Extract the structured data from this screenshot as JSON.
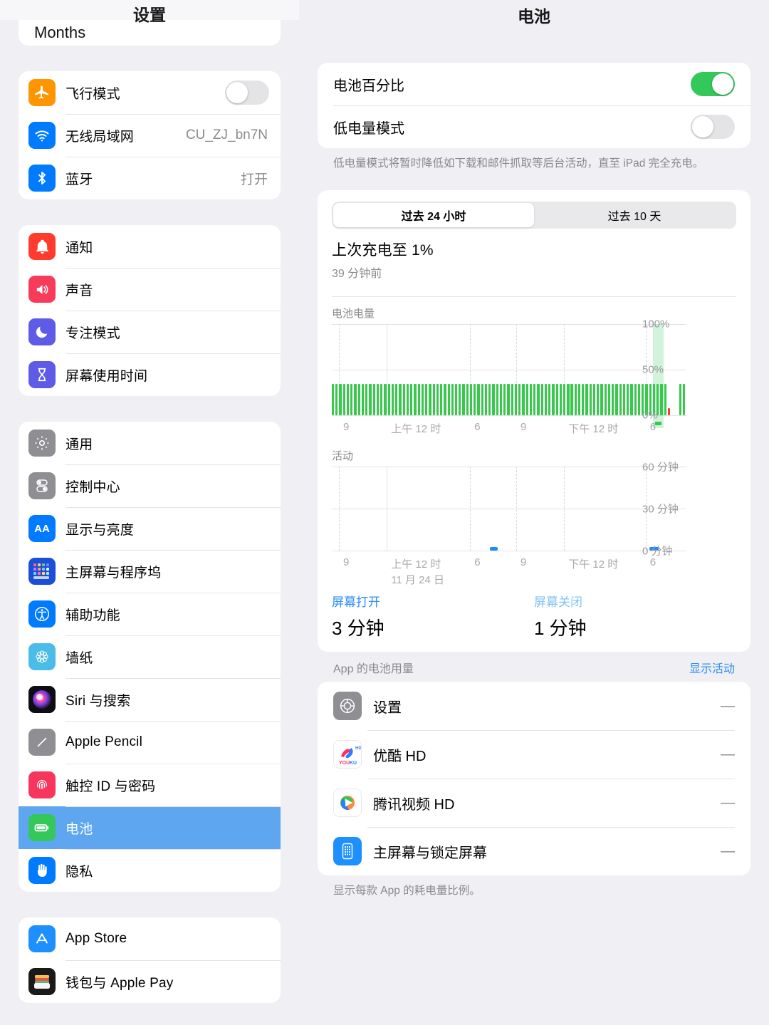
{
  "sidebar": {
    "title": "设置",
    "partial_top_label": "Months",
    "groups": [
      {
        "items": [
          {
            "label": "飞行模式",
            "icon": "airplane-icon",
            "control": "toggle",
            "toggle_on": false
          },
          {
            "label": "无线局域网",
            "icon": "wifi-icon",
            "value": "CU_ZJ_bn7N"
          },
          {
            "label": "蓝牙",
            "icon": "bluetooth-icon",
            "value": "打开"
          }
        ]
      },
      {
        "items": [
          {
            "label": "通知",
            "icon": "bell-icon"
          },
          {
            "label": "声音",
            "icon": "speaker-icon"
          },
          {
            "label": "专注模式",
            "icon": "moon-icon"
          },
          {
            "label": "屏幕使用时间",
            "icon": "hourglass-icon"
          }
        ]
      },
      {
        "items": [
          {
            "label": "通用",
            "icon": "gear-icon"
          },
          {
            "label": "控制中心",
            "icon": "sliders-icon"
          },
          {
            "label": "显示与亮度",
            "icon": "aa-icon"
          },
          {
            "label": "主屏幕与程序坞",
            "icon": "home-grid-icon"
          },
          {
            "label": "辅助功能",
            "icon": "accessibility-icon"
          },
          {
            "label": "墙纸",
            "icon": "wallpaper-icon"
          },
          {
            "label": "Siri 与搜索",
            "icon": "siri-icon"
          },
          {
            "label": "Apple Pencil",
            "icon": "pencil-icon"
          },
          {
            "label": "触控 ID 与密码",
            "icon": "touchid-icon"
          },
          {
            "label": "电池",
            "icon": "battery-icon",
            "selected": true
          },
          {
            "label": "隐私",
            "icon": "hand-icon"
          }
        ]
      },
      {
        "items": [
          {
            "label": "App Store",
            "icon": "appstore-icon"
          },
          {
            "label": "钱包与 Apple Pay",
            "icon": "wallet-icon"
          }
        ]
      }
    ]
  },
  "detail": {
    "title": "电池",
    "settings": {
      "battery_percentage_label": "电池百分比",
      "battery_percentage_on": true,
      "low_power_label": "低电量模式",
      "low_power_on": false,
      "footnote": "低电量模式将暂时降低如下载和邮件抓取等后台活动，直至 iPad 完全充电。"
    },
    "segmented": {
      "options": [
        "过去 24 小时",
        "过去 10 天"
      ],
      "selected_index": 0
    },
    "last_charge": {
      "title": "上次充电至 1%",
      "subtitle": "39 分钟前"
    },
    "screen_on": {
      "label": "屏幕打开",
      "value": "3 分钟"
    },
    "screen_off": {
      "label": "屏幕关闭",
      "value": "1 分钟"
    },
    "apps_section": {
      "title": "App 的电池用量",
      "action": "显示活动",
      "footnote": "显示每款 App 的耗电量比例。",
      "apps": [
        {
          "name": "设置",
          "value": "—",
          "icon": "settings-app-icon"
        },
        {
          "name": "优酷 HD",
          "value": "—",
          "icon": "youku-app-icon"
        },
        {
          "name": "腾讯视频 HD",
          "value": "—",
          "icon": "tencent-video-app-icon"
        },
        {
          "name": "主屏幕与锁定屏幕",
          "value": "—",
          "icon": "home-lock-screen-app-icon"
        }
      ]
    }
  },
  "chart_data": [
    {
      "type": "bar",
      "title": "电池电量",
      "ylabel": "",
      "xlabel": "",
      "ylim": [
        0,
        100
      ],
      "ytick_labels": [
        "100%",
        "50%",
        "0%"
      ],
      "ytick_values": [
        100,
        50,
        0
      ],
      "xtick_labels": [
        "9",
        "上午 12 时",
        "6",
        "9",
        "下午 12 时",
        "6"
      ],
      "xtick_positions": [
        0.02,
        0.155,
        0.39,
        0.52,
        0.655,
        0.885
      ],
      "grid": true,
      "bar_color": "#36C94B",
      "low_color": "#FF3B30",
      "charge_band_color": "rgba(52,199,89,0.22)",
      "charge_band_range": [
        0.905,
        0.935
      ],
      "values": [
        34,
        34,
        34,
        34,
        34,
        34,
        34,
        34,
        34,
        34,
        34,
        34,
        34,
        34,
        34,
        34,
        34,
        34,
        34,
        34,
        34,
        34,
        34,
        34,
        34,
        34,
        34,
        34,
        34,
        34,
        34,
        34,
        34,
        34,
        34,
        34,
        34,
        34,
        34,
        34,
        34,
        34,
        34,
        34,
        34,
        34,
        34,
        34,
        34,
        34,
        34,
        34,
        34,
        34,
        34,
        34,
        34,
        34,
        34,
        34,
        34,
        34,
        34,
        34,
        34,
        34,
        34,
        34,
        34,
        34,
        34,
        34,
        34,
        34,
        34,
        34,
        34,
        34,
        34,
        34,
        34,
        34,
        34,
        34,
        34,
        34,
        34,
        34,
        34,
        34,
        8,
        0,
        0,
        34,
        34
      ],
      "low_index": 90
    },
    {
      "type": "bar",
      "title": "活动",
      "ylim": [
        0,
        60
      ],
      "ytick_labels": [
        "60 分钟",
        "30 分钟",
        "0 分钟"
      ],
      "ytick_values": [
        60,
        30,
        0
      ],
      "xtick_labels": [
        "9",
        "上午 12 时",
        "6",
        "9",
        "下午 12 时",
        "6"
      ],
      "xtick_positions": [
        0.02,
        0.155,
        0.39,
        0.52,
        0.655,
        0.885
      ],
      "date_label": "11 月 24 日",
      "grid": true,
      "bar_color": "#1A8CFF",
      "points": [
        {
          "x": 0.445,
          "value": 1.5,
          "width": 0.022
        },
        {
          "x": 0.895,
          "value": 2.0,
          "width": 0.026
        }
      ]
    }
  ]
}
